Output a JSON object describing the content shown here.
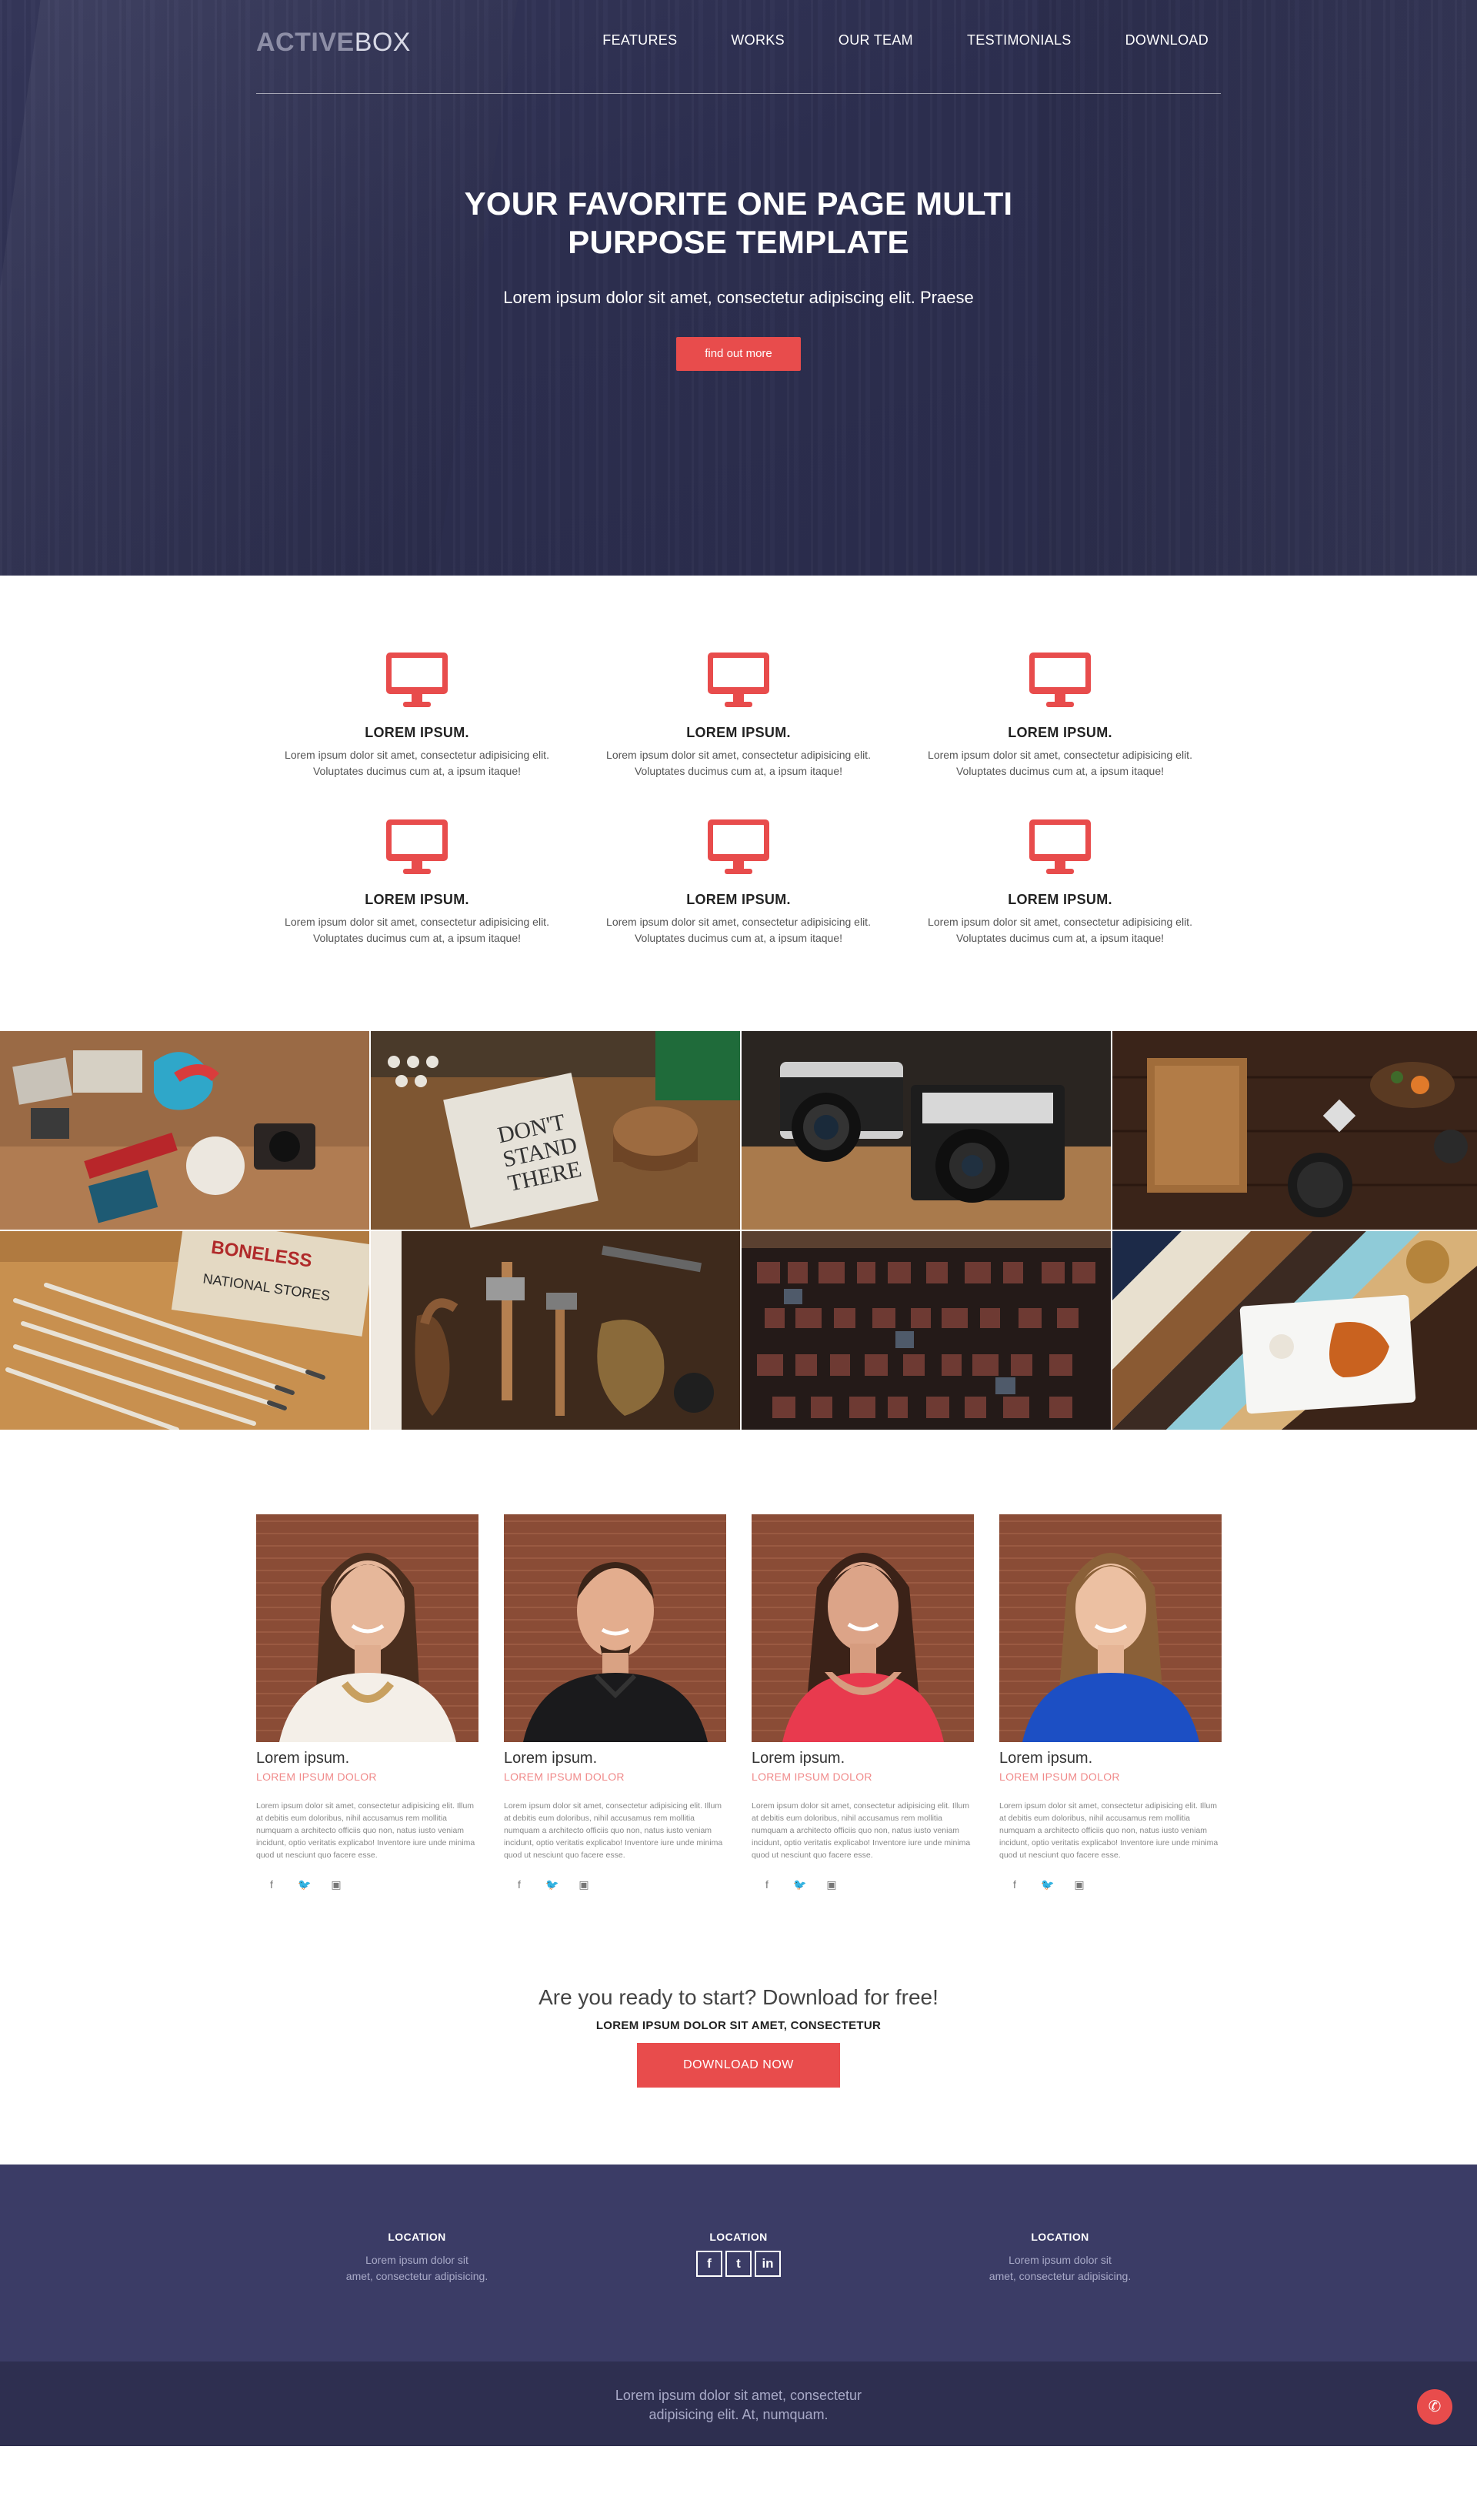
{
  "logo": {
    "part1": "ACTIVE",
    "part2": "BOX"
  },
  "nav": [
    "FEATURES",
    "WORKS",
    "OUR TEAM",
    "TESTIMONIALS",
    "DOWNLOAD"
  ],
  "hero": {
    "title": "YOUR FAVORITE ONE PAGE MULTI PURPOSE TEMPLATE",
    "subtitle": "Lorem ipsum dolor sit amet, consectetur adipiscing elit. Praese",
    "button": "find out more"
  },
  "features": [
    {
      "title": "LOREM IPSUM.",
      "line1": "Lorem ipsum dolor sit amet, consectetur adipisicing elit.",
      "line2": "Voluptates ducimus cum at, a ipsum itaque!"
    },
    {
      "title": "LOREM IPSUM.",
      "line1": "Lorem ipsum dolor sit amet, consectetur adipisicing elit.",
      "line2": "Voluptates ducimus cum at, a ipsum itaque!"
    },
    {
      "title": "LOREM IPSUM.",
      "line1": "Lorem ipsum dolor sit amet, consectetur adipisicing elit.",
      "line2": "Voluptates ducimus cum at, a ipsum itaque!"
    },
    {
      "title": "LOREM IPSUM.",
      "line1": "Lorem ipsum dolor sit amet, consectetur adipisicing elit.",
      "line2": "Voluptates ducimus cum at, a ipsum itaque!"
    },
    {
      "title": "LOREM IPSUM.",
      "line1": "Lorem ipsum dolor sit amet, consectetur adipisicing elit.",
      "line2": "Voluptates ducimus cum at, a ipsum itaque!"
    },
    {
      "title": "LOREM IPSUM.",
      "line1": "Lorem ipsum dolor sit amet, consectetur adipisicing elit.",
      "line2": "Voluptates ducimus cum at, a ipsum itaque!"
    }
  ],
  "team": [
    {
      "name": "Lorem ipsum.",
      "role": "LOREM IPSUM DOLOR",
      "bio": "Lorem ipsum dolor sit amet, consectetur adipisicing elit. Illum at debitis eum doloribus, nihil accusamus rem mollitia numquam a architecto officiis quo non, natus iusto veniam incidunt, optio veritatis explicabo! Inventore iure unde minima quod ut nesciunt quo facere esse."
    },
    {
      "name": "Lorem ipsum.",
      "role": "LOREM IPSUM DOLOR",
      "bio": "Lorem ipsum dolor sit amet, consectetur adipisicing elit. Illum at debitis eum doloribus, nihil accusamus rem mollitia numquam a architecto officiis quo non, natus iusto veniam incidunt, optio veritatis explicabo! Inventore iure unde minima quod ut nesciunt quo facere esse."
    },
    {
      "name": "Lorem ipsum.",
      "role": "LOREM IPSUM DOLOR",
      "bio": "Lorem ipsum dolor sit amet, consectetur adipisicing elit. Illum at debitis eum doloribus, nihil accusamus rem mollitia numquam a architecto officiis quo non, natus iusto veniam incidunt, optio veritatis explicabo! Inventore iure unde minima quod ut nesciunt quo facere esse."
    },
    {
      "name": "Lorem ipsum.",
      "role": "LOREM IPSUM DOLOR",
      "bio": "Lorem ipsum dolor sit amet, consectetur adipisicing elit. Illum at debitis eum doloribus, nihil accusamus rem mollitia numquam a architecto officiis quo non, natus iusto veniam incidunt, optio veritatis explicabo! Inventore iure unde minima quod ut nesciunt quo facere esse."
    }
  ],
  "cta": {
    "title": "Are you ready to start? Download for free!",
    "subtitle": "LOREM IPSUM DOLOR SIT AMET, CONSECTETUR",
    "button": "DOWNLOAD NOW"
  },
  "footer": {
    "col1": {
      "title": "LOCATION",
      "line1": "Lorem ipsum dolor sit",
      "line2": "amet, consectetur adipisicing."
    },
    "col2": {
      "title": "LOCATION"
    },
    "col3": {
      "title": "LOCATION",
      "line1": "Lorem ipsum dolor sit",
      "line2": "amet, consectetur adipisicing."
    },
    "copyright_line1": "Lorem ipsum dolor sit amet, consectetur",
    "copyright_line2": "adipisicing elit. At, numquam."
  },
  "colors": {
    "accent": "#e84c4c",
    "hero_bg": "#2f3152",
    "footer_bg": "#3b3c66",
    "bottom_bar": "#2e2f50"
  }
}
